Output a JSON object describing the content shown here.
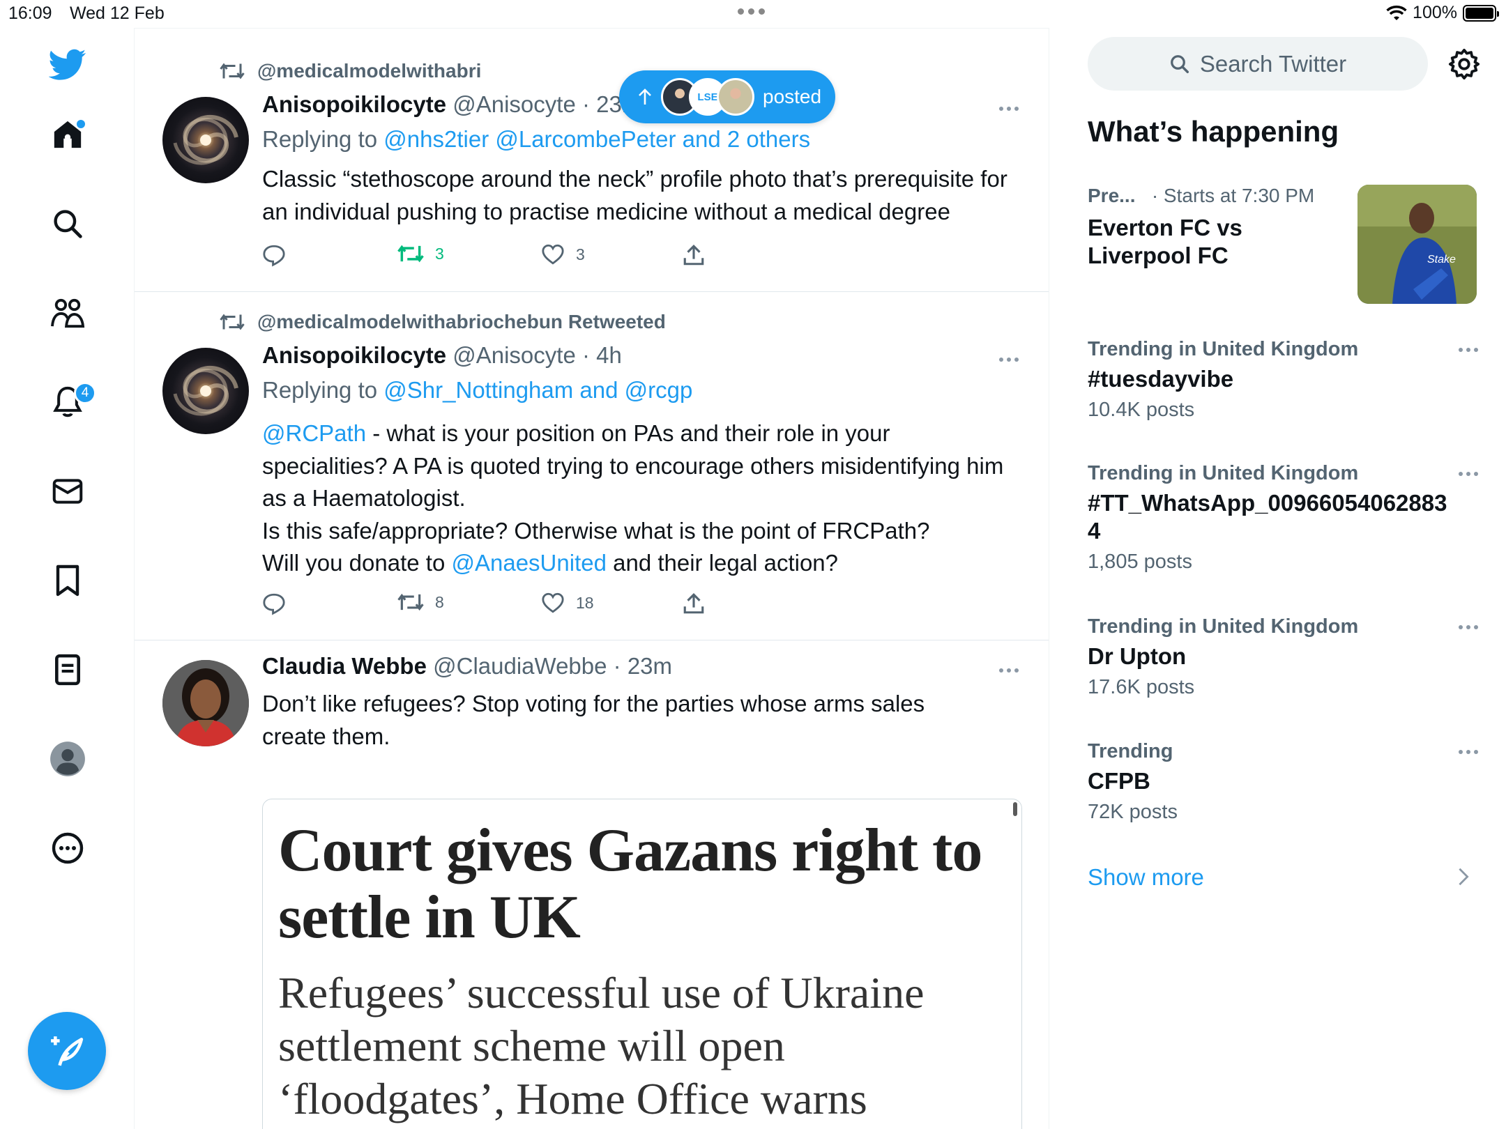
{
  "status_bar": {
    "time": "16:09",
    "date": "Wed 12 Feb",
    "battery_level_percent": 100,
    "battery": "100%"
  },
  "nav": {
    "notifications_count": "4",
    "items": [
      "twitter-logo",
      "home-icon",
      "search-icon",
      "communities-icon",
      "notifications-icon",
      "messages-icon",
      "bookmarks-icon",
      "lists-icon",
      "profile-icon",
      "more-icon",
      "compose-icon"
    ]
  },
  "new_posts_pill": {
    "label": "posted"
  },
  "tweets": [
    {
      "retweeted_by": "@medicalmodelwithabriochebun Retweeted",
      "name": "Anisopoikilocyte",
      "handle": "@Anisocyte",
      "sep": "·",
      "time": "23m",
      "replying_label": "Replying to",
      "replying_links": "@nhs2tier @LarcombePeter and 2 others",
      "text": "Classic “stethoscope around the neck” profile photo that’s prerequisite for an individual pushing to practise medicine without a medical degree",
      "retweets": "3",
      "likes": "3"
    },
    {
      "retweeted_by": "@medicalmodelwithabriochebun Retweeted",
      "name": "Anisopoikilocyte",
      "handle": "@Anisocyte",
      "sep": "·",
      "time": "4h",
      "replying_label": "Replying to",
      "replying_links": "@Shr_Nottingham and @rcgp",
      "mention1": "@RCPath",
      "text1": " - what is your position on PAs and their role in your specialities? A PA is quoted trying to encourage others misidentifying him as a Haematologist.",
      "text2": "Is this safe/appropriate? Otherwise what is the point of FRCPath?",
      "text3a": "Will you donate to ",
      "mention2": "@AnaesUnited",
      "text3b": " and their legal action?",
      "retweets": "8",
      "likes": "18"
    },
    {
      "name": "Claudia Webbe",
      "handle": "@ClaudiaWebbe",
      "sep": "·",
      "time": "23m",
      "text": "Don’t like refugees? Stop voting for the parties whose arms sales create them.",
      "card": {
        "headline": "Court gives Gazans right to settle in UK",
        "subheadline": "Refugees’ successful use of Ukraine settlement scheme will open ‘floodgates’, Home Office warns"
      }
    }
  ],
  "right": {
    "search_placeholder": "Search Twitter",
    "section_title": "What’s happening",
    "event": {
      "context": "Pre...",
      "time": "· Starts at 7:30 PM",
      "title": "Everton FC vs Liverpool FC"
    },
    "trends": [
      {
        "context": "Trending in United Kingdom",
        "name": "#tuesdayvibe",
        "count": "10.4K posts"
      },
      {
        "context": "Trending in United Kingdom",
        "name": "#TT_WhatsApp_009660540628834",
        "count": "1,805 posts"
      },
      {
        "context": "Trending in United Kingdom",
        "name": "Dr Upton",
        "count": "17.6K posts"
      },
      {
        "context": "Trending",
        "name": "CFPB",
        "count": "72K posts"
      }
    ],
    "show_more": "Show more"
  },
  "colors": {
    "accent": "#1d9bf0",
    "retweet_green": "#00ba7c",
    "secondary_text": "#536471"
  }
}
